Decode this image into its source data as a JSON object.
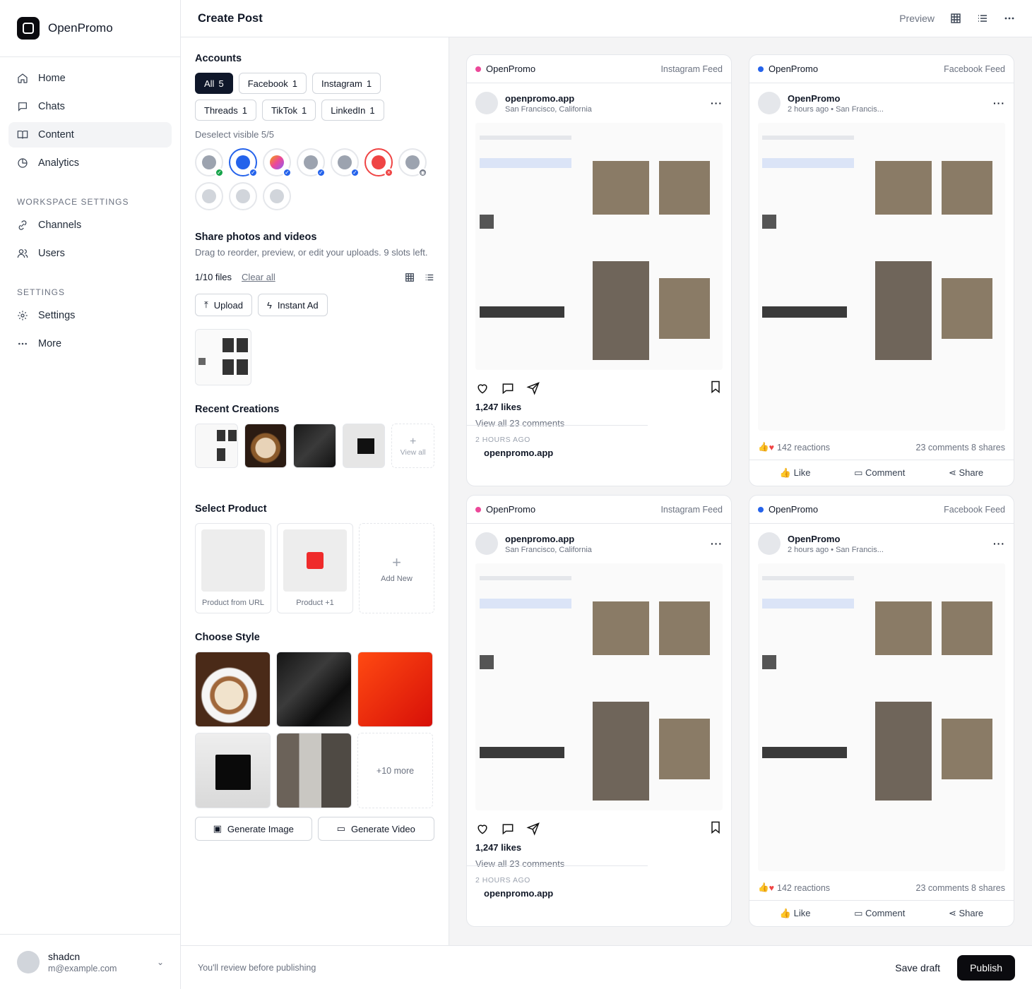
{
  "app": {
    "name": "OpenPromo"
  },
  "nav": {
    "items": [
      {
        "label": "Home"
      },
      {
        "label": "Chats"
      },
      {
        "label": "Content"
      },
      {
        "label": "Analytics"
      }
    ],
    "workspace_section": "WORKSPACE SETTINGS",
    "workspace_items": [
      {
        "label": "Channels"
      },
      {
        "label": "Users"
      }
    ],
    "settings_section": "SETTINGS",
    "settings_items": [
      {
        "label": "Settings"
      },
      {
        "label": "More"
      }
    ]
  },
  "user": {
    "name": "shadcn",
    "email": "m@example.com"
  },
  "header": {
    "title": "Create Post",
    "preview_label": "Preview"
  },
  "accounts": {
    "title": "Accounts",
    "chips": [
      {
        "label": "All",
        "count": "5"
      },
      {
        "label": "Facebook",
        "count": "1"
      },
      {
        "label": "Instagram",
        "count": "1"
      },
      {
        "label": "Threads",
        "count": "1"
      },
      {
        "label": "TikTok",
        "count": "1"
      },
      {
        "label": "LinkedIn",
        "count": "1"
      }
    ],
    "deselect": "Deselect visible 5/5"
  },
  "uploads": {
    "title": "Share photos and videos",
    "subtitle": "Drag to reorder, preview, or edit your uploads. 9 slots left.",
    "count": "1/10 files",
    "clear": "Clear all",
    "upload_label": "Upload",
    "instant_label": "Instant Ad"
  },
  "recent": {
    "title": "Recent Creations",
    "view_all": "View all"
  },
  "product": {
    "title": "Select Product",
    "from_url": "Product from URL",
    "product_plus": "Product +1",
    "add_new": "Add New"
  },
  "style": {
    "title": "Choose Style",
    "more": "+10 more",
    "gen_image": "Generate Image",
    "gen_video": "Generate Video"
  },
  "cards": [
    {
      "brand": "OpenPromo",
      "feed": "Instagram Feed",
      "name": "openpromo.app",
      "sub": "San Francisco, California",
      "likes": "1,247 likes",
      "user": "openpromo.app",
      "view": "View all 23 comments",
      "time": "2 HOURS AGO"
    },
    {
      "brand": "OpenPromo",
      "feed": "Facebook Feed",
      "name": "OpenPromo",
      "sub": "2 hours ago • San Francis...",
      "reactions": "142 reactions",
      "stats": "23 comments 8 shares",
      "like": "Like",
      "comment": "Comment",
      "share": "Share"
    },
    {
      "brand": "OpenPromo",
      "feed": "Instagram Feed",
      "name": "openpromo.app",
      "sub": "San Francisco, California",
      "likes": "1,247 likes",
      "user": "openpromo.app",
      "view": "View all 23 comments",
      "time": "2 HOURS AGO"
    },
    {
      "brand": "OpenPromo",
      "feed": "Facebook Feed",
      "name": "OpenPromo",
      "sub": "2 hours ago • San Francis...",
      "reactions": "142 reactions",
      "stats": "23 comments 8 shares",
      "like": "Like",
      "comment": "Comment",
      "share": "Share"
    }
  ],
  "footer": {
    "note": "You'll review before publishing",
    "save_draft": "Save draft",
    "publish": "Publish"
  },
  "colors": {
    "instagram": "#ec4899",
    "facebook": "#2563eb",
    "accent": "#0b0b0f"
  }
}
